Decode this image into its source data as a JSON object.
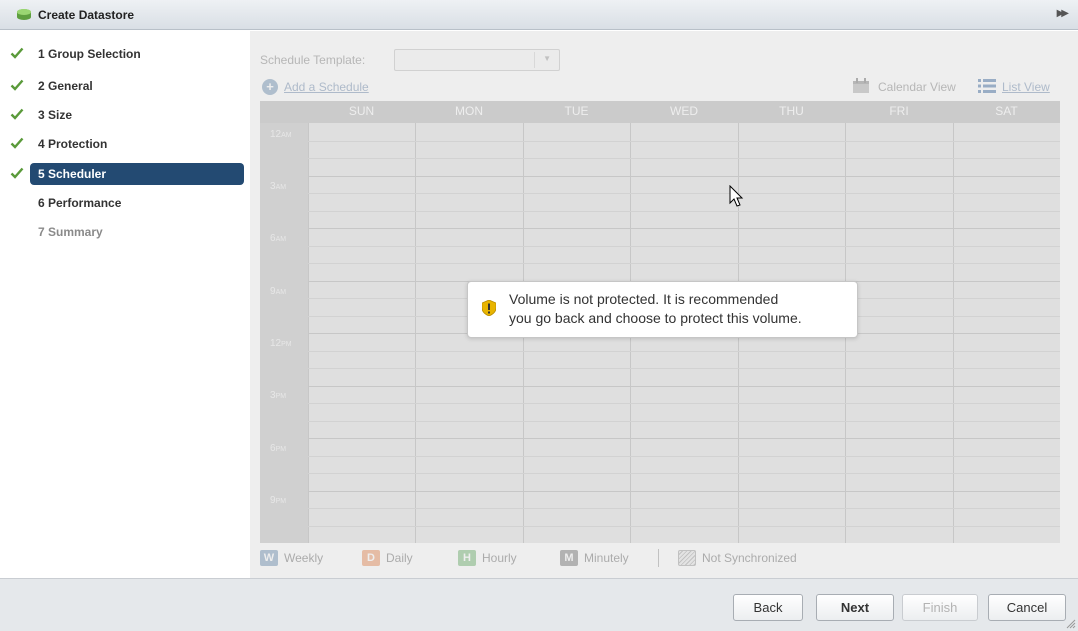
{
  "window": {
    "title": "Create Datastore",
    "icon": "datastore-icon"
  },
  "nav": {
    "steps": [
      {
        "label": "1 Group Selection",
        "state": "completed"
      },
      {
        "label": "2 General",
        "state": "completed"
      },
      {
        "label": "3 Size",
        "state": "completed"
      },
      {
        "label": "4 Protection",
        "state": "completed"
      },
      {
        "label": "5 Scheduler",
        "state": "active"
      },
      {
        "label": "6 Performance",
        "state": "pending"
      },
      {
        "label": "7 Summary",
        "state": "disabled"
      }
    ]
  },
  "scheduler": {
    "template_label": "Schedule Template:",
    "template_value": "",
    "add_schedule": "Add a Schedule",
    "calendar_view": "Calendar View",
    "list_view": "List View",
    "days": [
      "SUN",
      "MON",
      "TUE",
      "WED",
      "THU",
      "FRI",
      "SAT"
    ],
    "times": [
      {
        "num": "12",
        "ampm": "AM"
      },
      {
        "num": "3",
        "ampm": "AM"
      },
      {
        "num": "6",
        "ampm": "AM"
      },
      {
        "num": "9",
        "ampm": "AM"
      },
      {
        "num": "12",
        "ampm": "PM"
      },
      {
        "num": "3",
        "ampm": "PM"
      },
      {
        "num": "6",
        "ampm": "PM"
      },
      {
        "num": "9",
        "ampm": "PM"
      }
    ],
    "legend": [
      {
        "letter": "W",
        "label": "Weekly",
        "color": "#9fb6cc"
      },
      {
        "letter": "D",
        "label": "Daily",
        "color": "#f1b38f"
      },
      {
        "letter": "H",
        "label": "Hourly",
        "color": "#9ecc9e"
      },
      {
        "letter": "M",
        "label": "Minutely",
        "color": "#a3a3a3"
      }
    ],
    "legend_not_sync": "Not Synchronized"
  },
  "warning": {
    "text": "Volume is not protected.  It is recommended\nyou go back and choose to protect this volume."
  },
  "footer": {
    "back": "Back",
    "next": "Next",
    "finish": "Finish",
    "cancel": "Cancel"
  },
  "colors": {
    "active_step": "#234a72",
    "check": "#5a9a3a",
    "link": "#9db0c8"
  }
}
